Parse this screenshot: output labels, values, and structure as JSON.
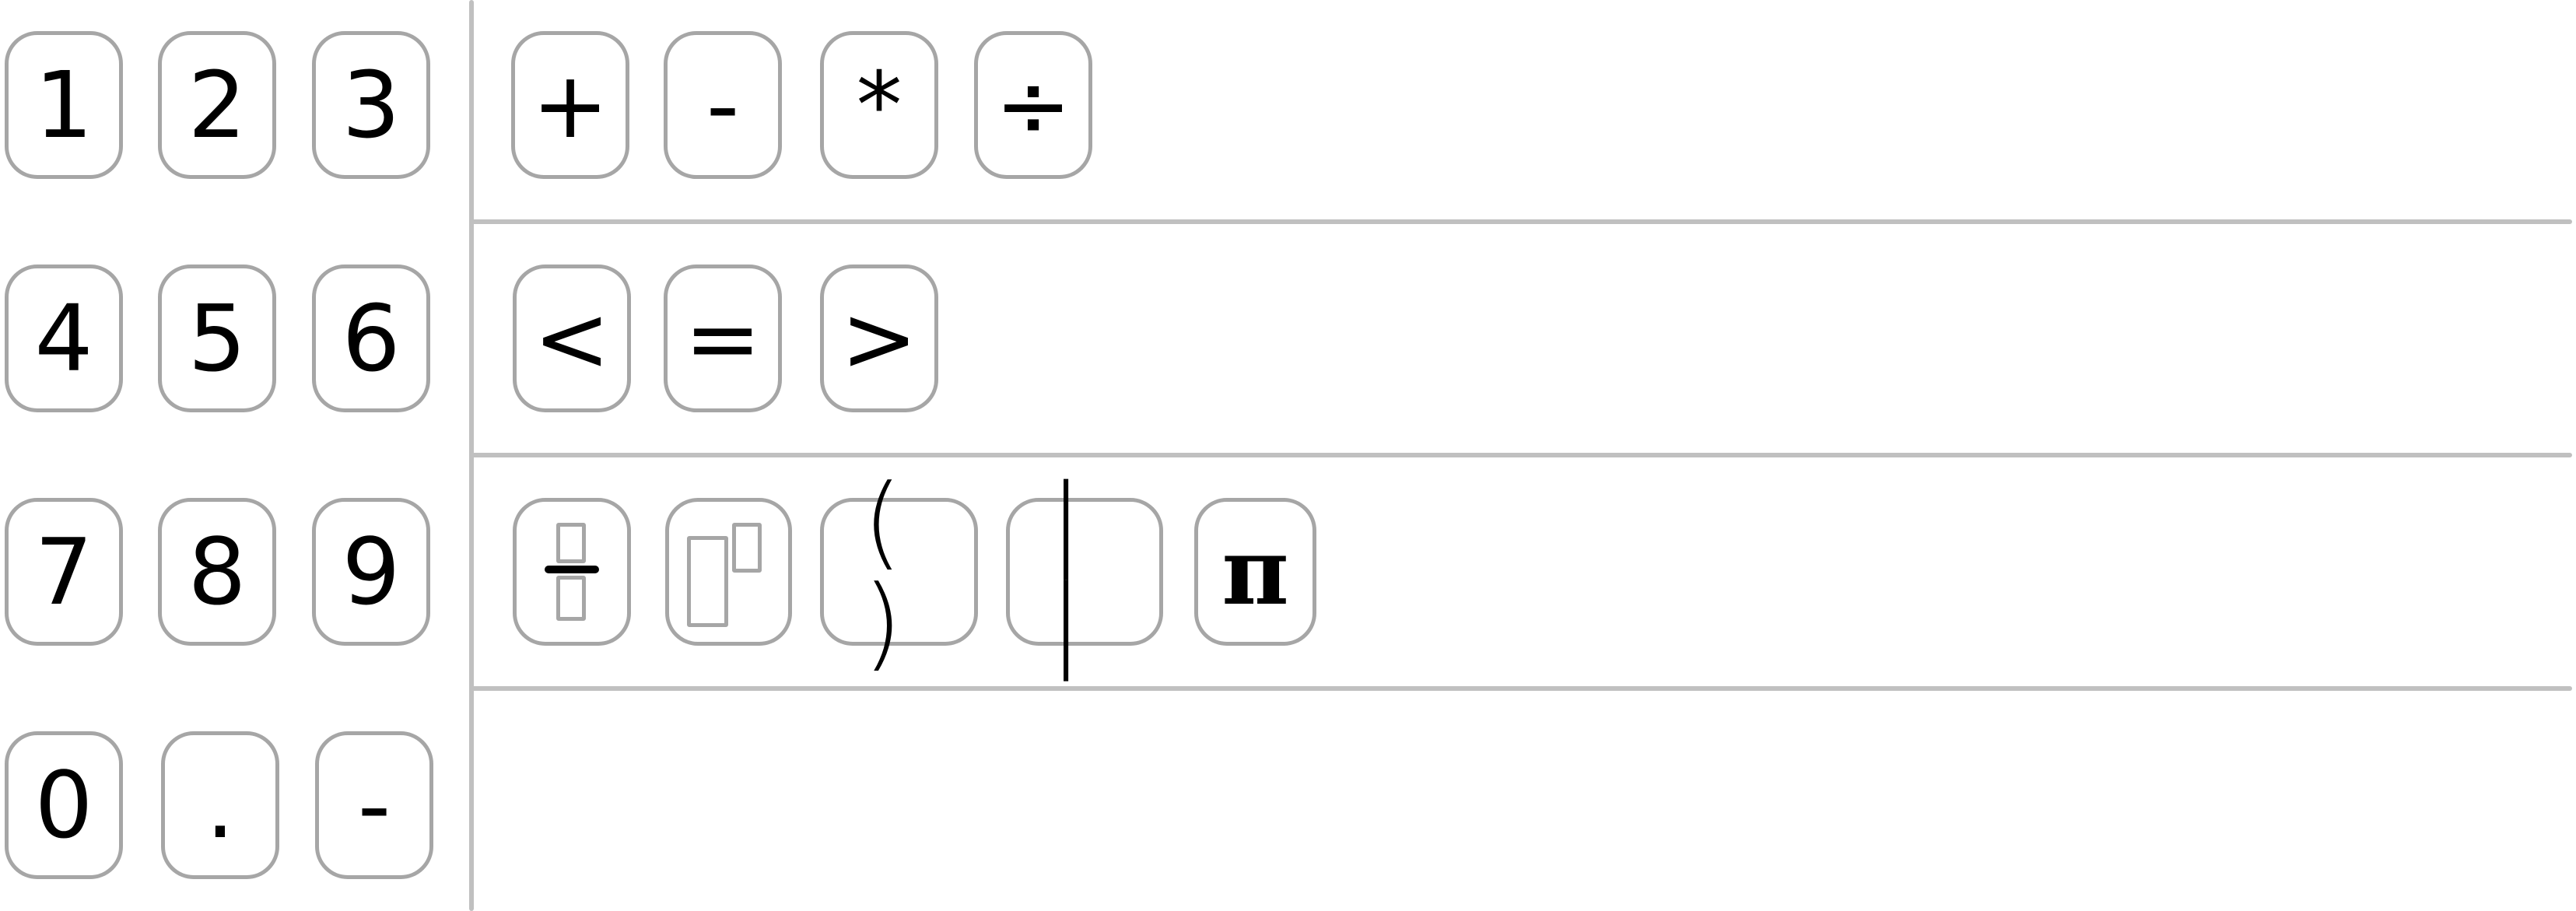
{
  "numpad": {
    "keys": [
      "1",
      "2",
      "3",
      "4",
      "5",
      "6",
      "7",
      "8",
      "9",
      "0",
      ".",
      "-"
    ]
  },
  "operators": {
    "arithmetic": [
      "+",
      "-",
      "*",
      "÷"
    ],
    "comparison": [
      "<",
      "=",
      ">"
    ],
    "special": {
      "fraction_icon": "fraction-template-icon",
      "power_icon": "exponent-template-icon",
      "parentheses": "( )",
      "absolute_value": "| |",
      "pi": "π"
    }
  },
  "colors": {
    "key_border": "#a6a6a6",
    "divider": "#c0c0c0",
    "text": "#000000"
  }
}
